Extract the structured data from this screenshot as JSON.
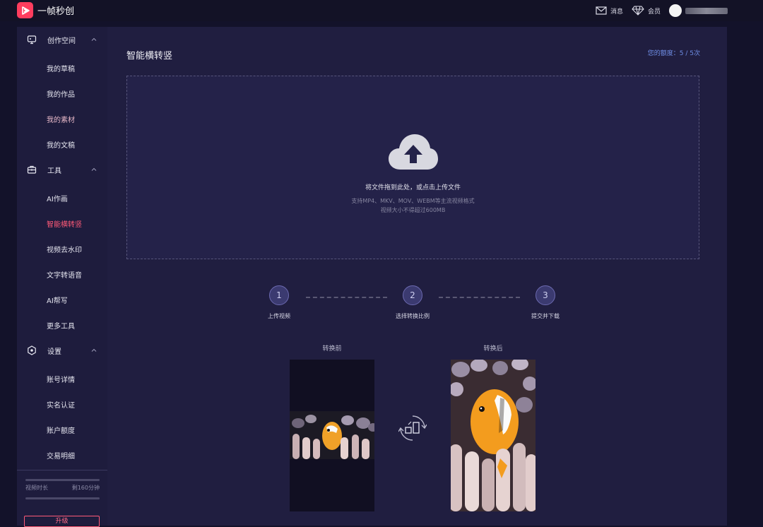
{
  "app": {
    "name": "一帧秒创"
  },
  "header": {
    "messages": "消息",
    "member": "会员"
  },
  "sidebar": {
    "groups": [
      {
        "label": "创作空间",
        "icon": "monitor-icon",
        "items": [
          "我的草稿",
          "我的作品",
          "我的素材",
          "我的文稿"
        ]
      },
      {
        "label": "工具",
        "icon": "toolbox-icon",
        "items": [
          "AI作画",
          "智能横转竖",
          "视频去水印",
          "文字转语音",
          "AI帮写",
          "更多工具"
        ]
      },
      {
        "label": "设置",
        "icon": "settings-icon",
        "items": [
          "账号详情",
          "实名认证",
          "账户额度",
          "交易明细"
        ]
      }
    ],
    "active_item": "智能横转竖",
    "usage": {
      "label": "视频时长",
      "value": "剩160分钟"
    },
    "upgrade": "升级"
  },
  "main": {
    "title": "智能横转竖",
    "quota": "您的额度：5 / 5次",
    "upload": {
      "main": "将文件拖到此处，或点击上传文件",
      "formats": "支持MP4、MKV、MOV、WEBM等主流视频格式",
      "size": "视频大小不得超过600MB"
    },
    "steps": [
      {
        "num": "1",
        "label": "上传视频"
      },
      {
        "num": "2",
        "label": "选择转换比例"
      },
      {
        "num": "3",
        "label": "提交并下载"
      }
    ],
    "preview": {
      "before": "转换前",
      "after": "转换后"
    }
  },
  "colors": {
    "brand": "#ff3d5e",
    "active": "#ff5a78",
    "quota": "#6f8ee6",
    "panel": "#201e40",
    "sidebar": "#1e1c3d"
  }
}
